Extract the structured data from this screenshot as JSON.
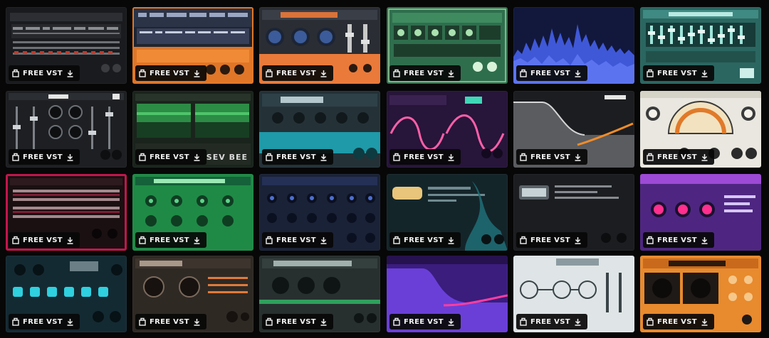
{
  "badge_label": "FREE VST",
  "colors": {
    "page_bg": "#070707",
    "badge_bg": "#080808",
    "badge_text": "#f2f2f2"
  },
  "icons": {
    "badge_left": "plugin-package-icon",
    "badge_right": "download-icon"
  },
  "tiles": [
    {
      "theme": "dark-grey",
      "caption": ""
    },
    {
      "theme": "orange-blue",
      "caption": ""
    },
    {
      "theme": "orange-knobs",
      "caption": ""
    },
    {
      "theme": "green-rack",
      "caption": ""
    },
    {
      "theme": "blue-waveform",
      "caption": ""
    },
    {
      "theme": "teal-faders",
      "caption": ""
    },
    {
      "theme": "dark-faders",
      "caption": ""
    },
    {
      "theme": "green-meters",
      "caption": "SEV BEE"
    },
    {
      "theme": "teal-compressor",
      "caption": ""
    },
    {
      "theme": "purple-filter",
      "caption": ""
    },
    {
      "theme": "grey-curve",
      "caption": ""
    },
    {
      "theme": "cream-vu",
      "caption": ""
    },
    {
      "theme": "red-black",
      "caption": ""
    },
    {
      "theme": "green-knobs",
      "caption": ""
    },
    {
      "theme": "navy-knobs",
      "caption": ""
    },
    {
      "theme": "teal-smoke",
      "caption": ""
    },
    {
      "theme": "dark-panel",
      "caption": ""
    },
    {
      "theme": "magenta-knobs",
      "caption": ""
    },
    {
      "theme": "teal-buttons",
      "caption": ""
    },
    {
      "theme": "brown-meters",
      "caption": ""
    },
    {
      "theme": "slate-rack",
      "caption": ""
    },
    {
      "theme": "violet-curve",
      "caption": ""
    },
    {
      "theme": "white-schematic",
      "caption": ""
    },
    {
      "theme": "orange-grid",
      "caption": ""
    }
  ]
}
